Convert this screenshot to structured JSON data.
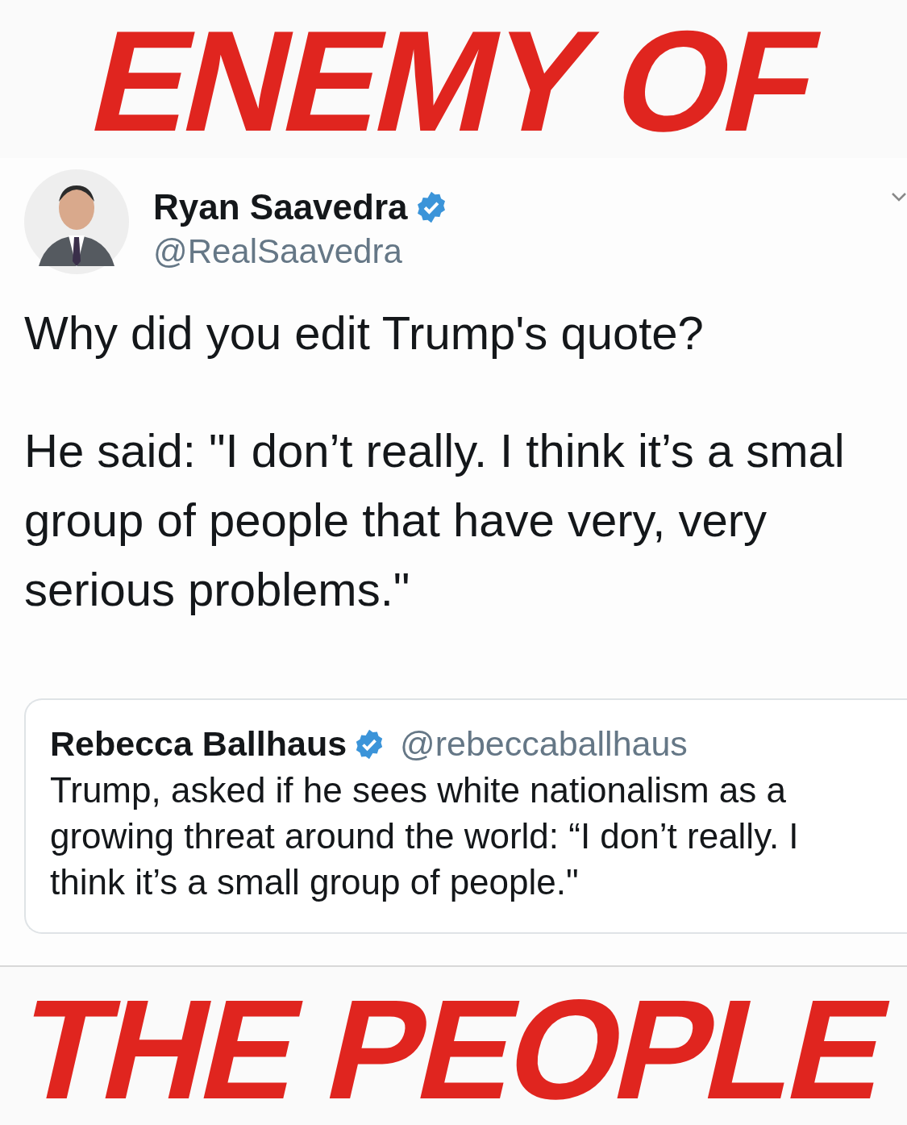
{
  "caption_top": "ENEMY OF",
  "tweet": {
    "author": {
      "name": "Ryan Saavedra",
      "verified": true,
      "handle": "@RealSaavedra"
    },
    "paragraphs": [
      {
        "lines": [
          "Why did you edit Trump's quote?"
        ]
      },
      {
        "lines": [
          "He said: \"I don’t really. I think it’s a smal",
          "group of people that have very, very",
          "serious problems.\""
        ]
      }
    ],
    "quoted": {
      "author": {
        "name": "Rebecca Ballhaus",
        "verified": true,
        "handle": "@rebeccaballhaus"
      },
      "lines": [
        "Trump, asked if he sees white nationalism as a",
        "growing threat around the world: “I don’t really. I",
        "think it’s a small group of people.\""
      ]
    }
  },
  "caption_bottom": "THE PEOPLE"
}
